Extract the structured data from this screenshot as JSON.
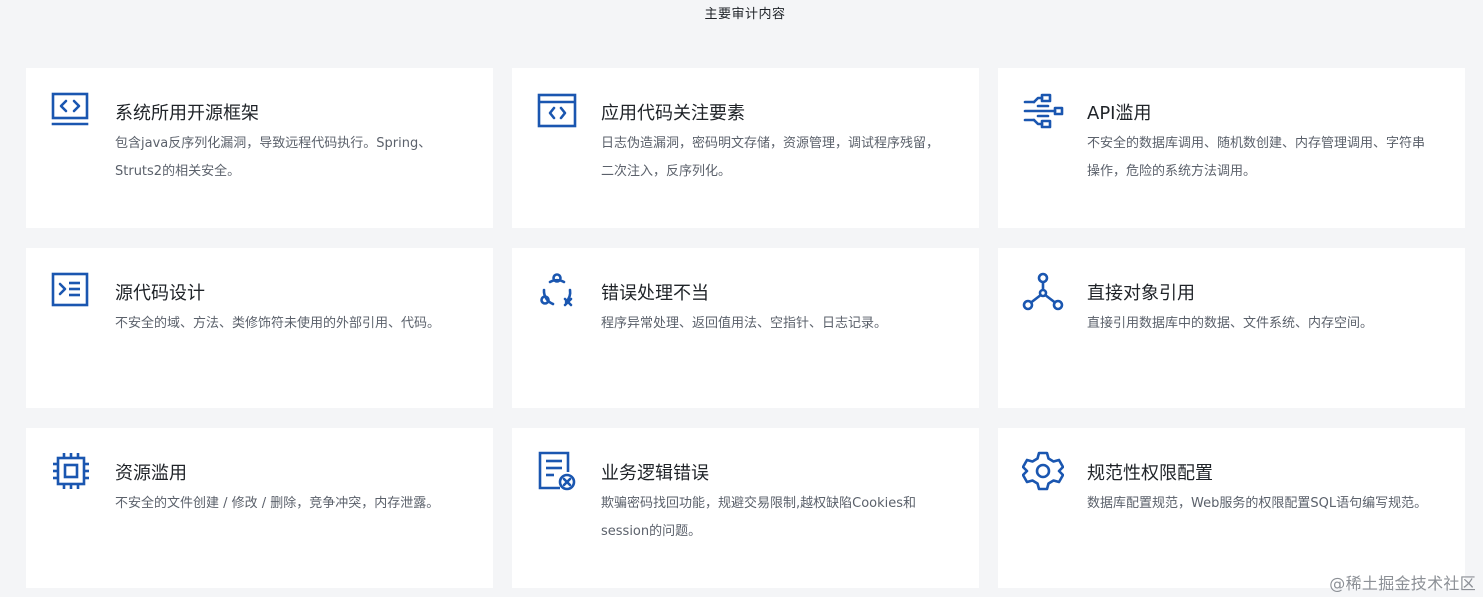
{
  "header": {
    "title": "主要审计内容"
  },
  "cards": [
    {
      "icon": "code-window-icon",
      "title": "系统所用开源框架",
      "desc": "包含java反序列化漏洞，导致远程代码执行。Spring、Struts2的相关安全。"
    },
    {
      "icon": "browser-code-icon",
      "title": "应用代码关注要素",
      "desc": "日志伪造漏洞，密码明文存储，资源管理，调试程序残留，二次注入，反序列化。"
    },
    {
      "icon": "api-network-icon",
      "title": "API滥用",
      "desc": "不安全的数据库调用、随机数创建、内存管理调用、字符串操作，危险的系统方法调用。"
    },
    {
      "icon": "terminal-list-icon",
      "title": "源代码设计",
      "desc": "不安全的域、方法、类修饰符未使用的外部引用、代码。"
    },
    {
      "icon": "error-cycle-icon",
      "title": "错误处理不当",
      "desc": "程序异常处理、返回值用法、空指针、日志记录。"
    },
    {
      "icon": "node-graph-icon",
      "title": "直接对象引用",
      "desc": "直接引用数据库中的数据、文件系统、内存空间。"
    },
    {
      "icon": "chip-icon",
      "title": "资源滥用",
      "desc": "不安全的文件创建 / 修改 / 删除，竞争冲突，内存泄露。"
    },
    {
      "icon": "document-error-icon",
      "title": "业务逻辑错误",
      "desc": "欺骗密码找回功能，规避交易限制,越权缺陷Cookies和session的问题。"
    },
    {
      "icon": "gear-icon",
      "title": "规范性权限配置",
      "desc": "数据库配置规范，Web服务的权限配置SQL语句编写规范。"
    }
  ],
  "watermark": {
    "text": "@稀土掘金技术社区"
  },
  "colors": {
    "background": "#f4f5f7",
    "card": "#ffffff",
    "icon": "#1a56b0",
    "title": "#1f2328",
    "text": "#5b616b"
  }
}
